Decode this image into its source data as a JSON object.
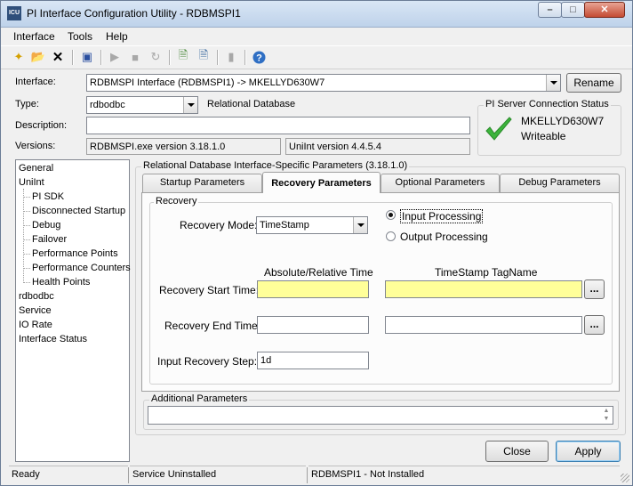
{
  "window": {
    "title": "PI Interface Configuration Utility - RDBMSPI1",
    "app_icon": "ICU"
  },
  "menu": [
    "Interface",
    "Tools",
    "Help"
  ],
  "toolbar_icons": [
    "new-icon",
    "open-icon",
    "delete-icon",
    "save-icon",
    "start-icon",
    "stop-icon",
    "restart-icon",
    "view-log-icon",
    "view-config-icon",
    "properties-icon",
    "help-icon"
  ],
  "interface": {
    "label": "Interface:",
    "value": "RDBMSPI Interface (RDBMSPI1) -> MKELLYD630W7",
    "rename_label": "Rename"
  },
  "type": {
    "label": "Type:",
    "value": "rdbodbc",
    "description": "Relational Database"
  },
  "description": {
    "label": "Description:",
    "value": ""
  },
  "versions": {
    "label": "Versions:",
    "exe": "RDBMSPI.exe version 3.18.1.0",
    "uniint": "UniInt version 4.4.5.4"
  },
  "server_status": {
    "title": "PI Server Connection Status",
    "server": "MKELLYD630W7",
    "state": "Writeable",
    "check_color": "#3cb43c"
  },
  "tree": [
    {
      "label": "General",
      "indent": 0
    },
    {
      "label": "UniInt",
      "indent": 0
    },
    {
      "label": "PI SDK",
      "indent": 1
    },
    {
      "label": "Disconnected Startup",
      "indent": 1
    },
    {
      "label": "Debug",
      "indent": 1
    },
    {
      "label": "Failover",
      "indent": 1
    },
    {
      "label": "Performance Points",
      "indent": 1
    },
    {
      "label": "Performance Counters",
      "indent": 1
    },
    {
      "label": "Health Points",
      "indent": 1
    },
    {
      "label": "rdbodbc",
      "indent": 0
    },
    {
      "label": "Service",
      "indent": 0
    },
    {
      "label": "IO Rate",
      "indent": 0
    },
    {
      "label": "Interface Status",
      "indent": 0
    }
  ],
  "params_group_title": "Relational Database Interface-Specific Parameters (3.18.1.0)",
  "tabs": [
    "Startup Parameters",
    "Recovery Parameters",
    "Optional Parameters",
    "Debug Parameters"
  ],
  "recovery": {
    "group_title": "Recovery",
    "mode_label": "Recovery Mode:",
    "mode_value": "TimeStamp",
    "input_processing": "Input Processing",
    "output_processing": "Output Processing",
    "col_abs": "Absolute/Relative Time",
    "col_tag": "TimeStamp TagName",
    "start_label": "Recovery Start Time:",
    "end_label": "Recovery End Time:",
    "step_label": "Input Recovery Step:",
    "step_value": "1d",
    "browse": "...",
    "highlight_color": "#ffff99"
  },
  "additional": {
    "title": "Additional Parameters",
    "value": ""
  },
  "buttons": {
    "close": "Close",
    "apply": "Apply"
  },
  "status": {
    "ready": "Ready",
    "service": "Service Uninstalled",
    "install": "RDBMSPI1 - Not Installed"
  }
}
